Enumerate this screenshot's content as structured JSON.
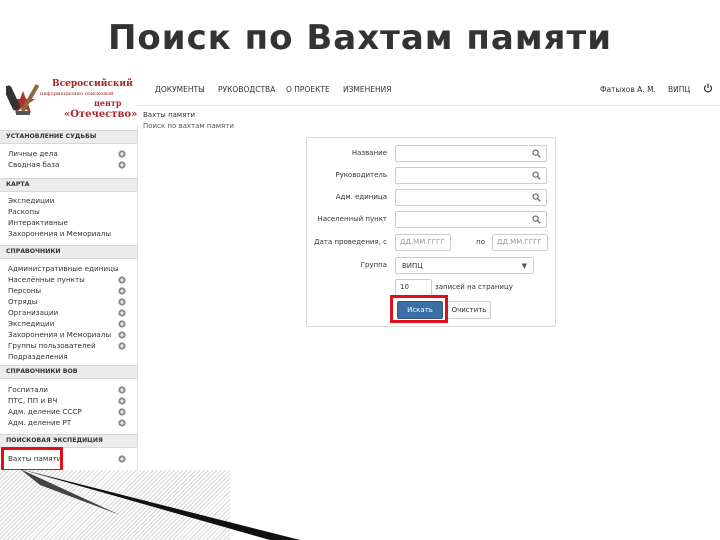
{
  "slide": {
    "title": "Поиск по Вахтам памяти"
  },
  "logo": {
    "line1": "Всероссийский",
    "line2": "информационно-поисковый",
    "line3": "центр",
    "line4": "«Отечество»"
  },
  "topnav": {
    "items": [
      "ДОКУМЕНТЫ",
      "РУКОВОДСТВА",
      "О ПРОЕКТЕ",
      "ИЗМЕНЕНИЯ"
    ],
    "user": "Фатыхов А. М.",
    "org": "ВИПЦ"
  },
  "breadcrumb": {
    "title": "Вахты памяти",
    "sub": "Поиск по вахтам памяти"
  },
  "sidebar": {
    "sections": [
      {
        "title": "УСТАНОВЛЕНИЕ СУДЬБЫ",
        "items": [
          {
            "label": "Личные дела",
            "plus": true
          },
          {
            "label": "Сводная база",
            "plus": true
          }
        ]
      },
      {
        "title": "КАРТА",
        "items": [
          {
            "label": "Экспедиции",
            "plus": false
          },
          {
            "label": "Раскопы",
            "plus": false
          },
          {
            "label": "Интерактивные",
            "plus": false
          },
          {
            "label": "Захоронения и Мемориалы",
            "plus": false
          }
        ]
      },
      {
        "title": "СПРАВОЧНИКИ",
        "items": [
          {
            "label": "Административные единицы",
            "plus": false
          },
          {
            "label": "Населённые пункты",
            "plus": true
          },
          {
            "label": "Персоны",
            "plus": true
          },
          {
            "label": "Отряды",
            "plus": true
          },
          {
            "label": "Организации",
            "plus": true
          },
          {
            "label": "Экспедиции",
            "plus": true
          },
          {
            "label": "Захоронения и Мемориалы",
            "plus": true
          },
          {
            "label": "Группы пользователей",
            "plus": true
          },
          {
            "label": "Подразделения",
            "plus": false
          }
        ]
      },
      {
        "title": "СПРАВОЧНИКИ ВОВ",
        "items": [
          {
            "label": "Госпитали",
            "plus": true
          },
          {
            "label": "ПТС, ПП и ВЧ",
            "plus": true
          },
          {
            "label": "Адм. деление СССР",
            "plus": true
          },
          {
            "label": "Адм. деление РТ",
            "plus": true
          }
        ]
      },
      {
        "title": "ПОИСКОВАЯ ЭКСПЕДИЦИЯ",
        "items": [
          {
            "label": "Вахты памяти",
            "plus": true
          }
        ]
      }
    ]
  },
  "form": {
    "fields": [
      {
        "label": "Название",
        "value": ""
      },
      {
        "label": "Руководитель",
        "value": ""
      },
      {
        "label": "Адм. единица",
        "value": ""
      },
      {
        "label": "Населенный пункт",
        "value": ""
      }
    ],
    "date_label": "Дата проведения, с",
    "date_from_placeholder": "ДД.ММ.ГГГГ",
    "date_to_label": "по",
    "date_to_placeholder": "ДД.ММ.ГГГГ",
    "group_label": "Группа",
    "group_value": "ВИПЦ",
    "per_page_value": "10",
    "per_page_label": "записей на страницу",
    "search_button": "Искать",
    "clear_button": "Очистить"
  },
  "colors": {
    "accent": "#3b6ea5",
    "highlight": "#e0101a",
    "logo": "#a5272a"
  }
}
